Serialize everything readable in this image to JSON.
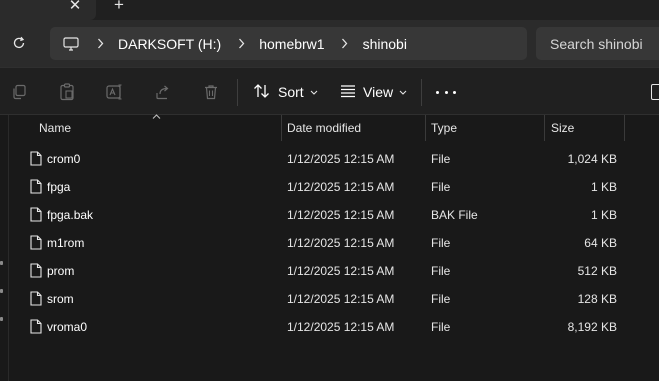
{
  "tabstrip": {
    "close_icon": "close-icon",
    "new_tab_icon": "plus-icon",
    "close_glyph": "✕",
    "new_glyph": "+"
  },
  "navigation": {
    "refresh_icon": "refresh-icon",
    "breadcrumb": {
      "root_icon": "this-pc-icon",
      "items": [
        "DARKSOFT (H:)",
        "homebrw1",
        "shinobi"
      ]
    },
    "search": {
      "placeholder": "Search shinobi"
    }
  },
  "command_bar": {
    "icons": [
      "copy-icon",
      "paste-icon",
      "rename-icon",
      "share-icon",
      "delete-icon"
    ],
    "sort_label": "Sort",
    "view_label": "View",
    "more_icon": "more-options-icon"
  },
  "columns": {
    "name": "Name",
    "date": "Date modified",
    "type": "Type",
    "size": "Size"
  },
  "files": [
    {
      "name": "crom0",
      "date": "1/12/2025 12:15 AM",
      "type": "File",
      "size": "1,024 KB"
    },
    {
      "name": "fpga",
      "date": "1/12/2025 12:15 AM",
      "type": "File",
      "size": "1 KB"
    },
    {
      "name": "fpga.bak",
      "date": "1/12/2025 12:15 AM",
      "type": "BAK File",
      "size": "1 KB"
    },
    {
      "name": "m1rom",
      "date": "1/12/2025 12:15 AM",
      "type": "File",
      "size": "64 KB"
    },
    {
      "name": "prom",
      "date": "1/12/2025 12:15 AM",
      "type": "File",
      "size": "512 KB"
    },
    {
      "name": "srom",
      "date": "1/12/2025 12:15 AM",
      "type": "File",
      "size": "128 KB"
    },
    {
      "name": "vroma0",
      "date": "1/12/2025 12:15 AM",
      "type": "File",
      "size": "8,192 KB"
    }
  ],
  "colors": {
    "background": "#191919",
    "toolbar": "#202020",
    "address_bar": "#373737",
    "text": "#ffffff",
    "disabled_icon": "#6b6b6b"
  }
}
